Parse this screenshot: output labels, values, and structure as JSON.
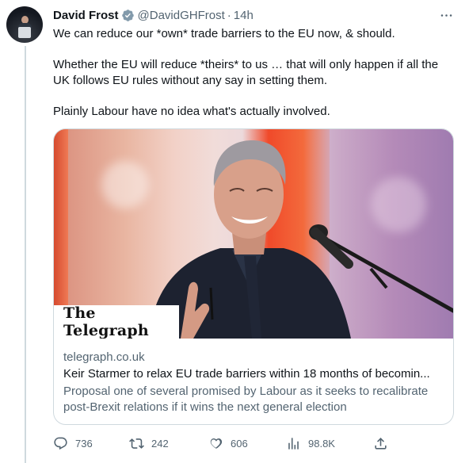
{
  "author": {
    "name": "David Frost",
    "handle": "@DavidGHFrost",
    "separator": "·",
    "time": "14h"
  },
  "tweet": {
    "lines": [
      "We can reduce our *own* trade barriers to the EU now, & should.",
      "Whether the EU will reduce *theirs* to us … that will only happen if all the",
      "UK follows EU rules without any say in setting them.",
      "Plainly Labour have no idea what's actually involved."
    ]
  },
  "card": {
    "logo_text": "The Telegraph",
    "domain": "telegraph.co.uk",
    "title": "Keir Starmer to relax EU trade barriers within 18 months of becomin...",
    "description": "Proposal one of several promised by Labour as it seeks to recalibrate post-Brexit relations if it wins the next general election"
  },
  "actions": {
    "reply": {
      "icon": "reply-icon",
      "count": "736"
    },
    "retweet": {
      "icon": "retweet-icon",
      "count": "242"
    },
    "like": {
      "icon": "like-icon",
      "count": "606"
    },
    "views": {
      "icon": "views-icon",
      "count": "98.8K"
    },
    "share": {
      "icon": "share-icon"
    }
  },
  "colors": {
    "text": "#0f1419",
    "secondary": "#536471",
    "verified": "#829aab",
    "border": "#cfd9de"
  }
}
